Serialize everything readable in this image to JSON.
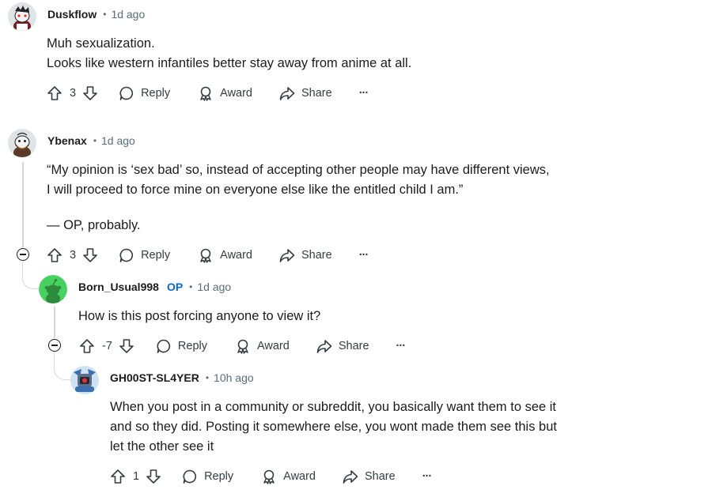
{
  "comments": [
    {
      "username": "Duskflow",
      "time": "1d ago",
      "lines": [
        "Muh sexualization.",
        "Looks like western infantiles better stay away from anime at all."
      ],
      "votes": "3",
      "reply": "Reply",
      "award": "Award",
      "share": "Share",
      "more": "···"
    },
    {
      "username": "Ybenax",
      "time": "1d ago",
      "lines": [
        "“My opinion is ‘sex bad’ so, instead of accepting other people may have different views,",
        "I will proceed to force mine on everyone else like the entitled child I am.”"
      ],
      "sign": "— OP, probably.",
      "votes": "3",
      "reply": "Reply",
      "award": "Award",
      "share": "Share",
      "more": "···"
    },
    {
      "username": "Born_Usual998",
      "op_badge": "OP",
      "time": "1d ago",
      "lines": [
        "How is this post forcing anyone to view it?"
      ],
      "votes": "-7",
      "reply": "Reply",
      "award": "Award",
      "share": "Share",
      "more": "···"
    },
    {
      "username": "GH00ST-SL4YER",
      "time": "10h ago",
      "lines": [
        "When you post in a community or subreddit, you basically want them to see it",
        "and so they did. Posting it somewhere else, you wont made them see this but",
        "let the other see it"
      ],
      "votes": "1",
      "reply": "Reply",
      "award": "Award",
      "share": "Share",
      "more": "···"
    }
  ],
  "separator_dot": "•",
  "colors": {
    "meta": "#576f76",
    "op_badge": "#0a66d0",
    "thread_line": "#d4d9dc",
    "text": "#1c1c1c"
  },
  "icons": [
    "upvote-icon",
    "downvote-icon",
    "reply-bubble-icon",
    "award-icon",
    "share-arrow-icon",
    "more-icon",
    "collapse-icon"
  ]
}
